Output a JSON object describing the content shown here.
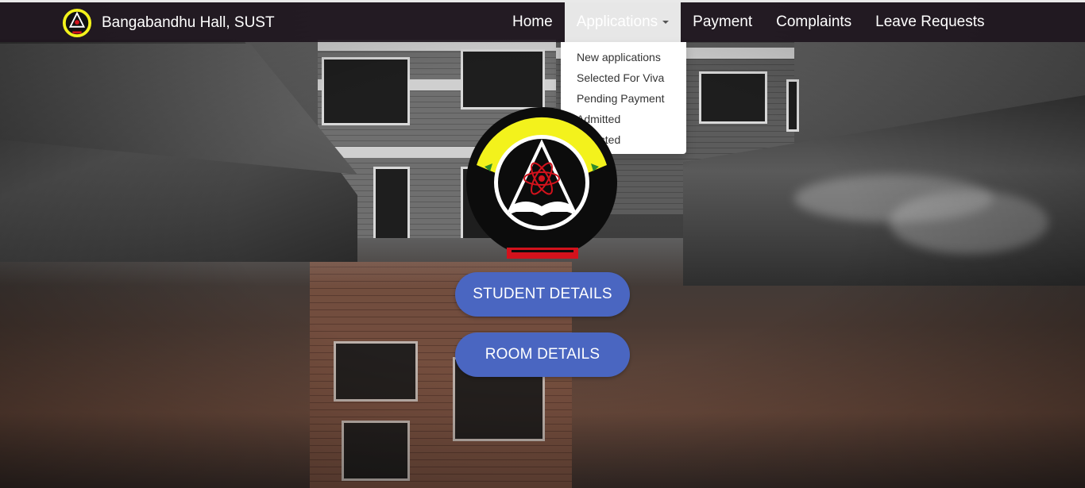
{
  "brand": {
    "title": "Bangabandhu Hall, SUST"
  },
  "nav": {
    "items": [
      {
        "label": "Home"
      },
      {
        "label": "Applications",
        "open": true
      },
      {
        "label": "Payment"
      },
      {
        "label": "Complaints"
      },
      {
        "label": "Leave Requests"
      }
    ]
  },
  "applications_menu": {
    "items": [
      "New applications",
      "Selected For Viva",
      "Pending Payment",
      "Admitted",
      "Rejected"
    ]
  },
  "main": {
    "buttons": [
      {
        "label": "STUDENT DETAILS"
      },
      {
        "label": "ROOM DETAILS"
      }
    ]
  },
  "colors": {
    "navbar": "#1e161e",
    "button": "#4a66c1",
    "dropdown_bg": "#ffffff",
    "emblem_yellow": "#f3f21c",
    "emblem_red": "#d3121c"
  },
  "icons": {
    "brand_logo": "university-logo-icon",
    "emblem": "university-emblem-icon",
    "caret": "caret-down-icon"
  }
}
